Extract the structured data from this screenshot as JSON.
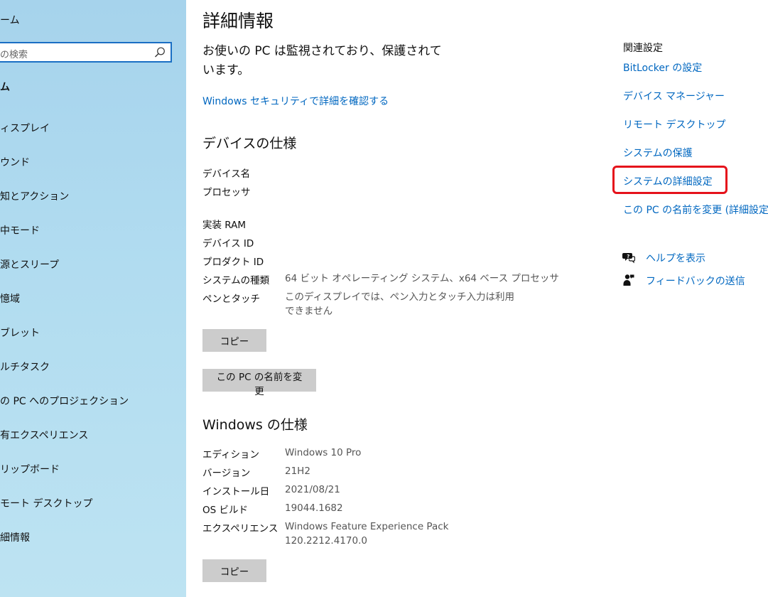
{
  "sidebar": {
    "home_label": "ーム",
    "search_placeholder": "の検索",
    "section_header": "ム",
    "items": [
      {
        "label": "ィスプレイ"
      },
      {
        "label": "ウンド"
      },
      {
        "label": "知とアクション"
      },
      {
        "label": "中モード"
      },
      {
        "label": "源とスリープ"
      },
      {
        "label": "憶域"
      },
      {
        "label": "ブレット"
      },
      {
        "label": "ルチタスク"
      },
      {
        "label": "の PC へのプロジェクション"
      },
      {
        "label": "有エクスペリエンス"
      },
      {
        "label": "リップボード"
      },
      {
        "label": "モート デスクトップ"
      },
      {
        "label": "細情報"
      }
    ]
  },
  "main": {
    "title": "詳細情報",
    "status_text": "お使いの PC は監視されており、保護されています。",
    "security_link": "Windows セキュリティで詳細を確認する",
    "device_spec": {
      "heading": "デバイスの仕様",
      "rows": [
        {
          "label": "デバイス名",
          "value": ""
        },
        {
          "label": "プロセッサ",
          "value": ""
        },
        {
          "label": "実装 RAM",
          "value": ""
        },
        {
          "label": "デバイス ID",
          "value": ""
        },
        {
          "label": "プロダクト ID",
          "value": ""
        },
        {
          "label": "システムの種類",
          "value": "64 ビット オペレーティング システム、x64 ベース プロセッサ"
        },
        {
          "label": "ペンとタッチ",
          "value": "このディスプレイでは、ペン入力とタッチ入力は利用できません"
        }
      ],
      "copy_button": "コピー",
      "rename_button": "この PC の名前を変更"
    },
    "windows_spec": {
      "heading": "Windows の仕様",
      "rows": [
        {
          "label": "エディション",
          "value": "Windows 10 Pro"
        },
        {
          "label": "バージョン",
          "value": "21H2"
        },
        {
          "label": "インストール日",
          "value": "2021/08/21"
        },
        {
          "label": "OS ビルド",
          "value": "19044.1682"
        },
        {
          "label": "エクスペリエンス",
          "value": "Windows Feature Experience Pack 120.2212.4170.0"
        }
      ],
      "copy_button": "コピー"
    }
  },
  "related": {
    "title": "関連設定",
    "links": [
      {
        "label": "BitLocker の設定"
      },
      {
        "label": "デバイス マネージャー"
      },
      {
        "label": "リモート デスクトップ"
      },
      {
        "label": "システムの保護"
      },
      {
        "label": "システムの詳細設定"
      },
      {
        "label": "この PC の名前を変更 (詳細設定)"
      }
    ],
    "help_label": "ヘルプを表示",
    "feedback_label": "フィードバックの送信",
    "highlight_color": "#e5121b",
    "link_color": "#0067c0"
  }
}
